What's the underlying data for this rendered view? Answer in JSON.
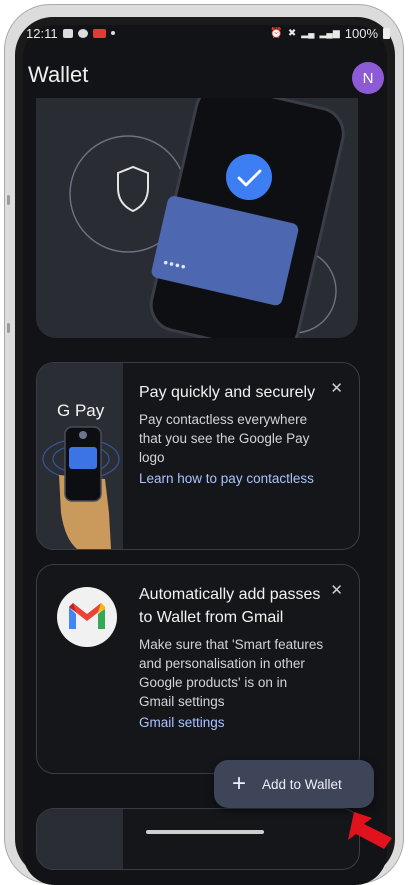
{
  "status_bar": {
    "time": "12:11",
    "battery": "100%"
  },
  "header": {
    "title": "Wallet",
    "avatar_initial": "N"
  },
  "cards": [
    {
      "title": "Pay quickly and securely",
      "text": "Pay contactless everywhere that you see the Google Pay logo",
      "link": "Learn how to pay contactless",
      "media_logo": "G Pay"
    },
    {
      "title": "Automatically add passes to Wallet from Gmail",
      "text": "Make sure that 'Smart features and personalisation in other Google products' is on in Gmail settings",
      "link": "Gmail settings"
    }
  ],
  "fab": {
    "label": "Add to Wallet"
  },
  "colors": {
    "background": "#121316",
    "card_border": "#3b3d45",
    "link": "#a9c3ff",
    "avatar": "#8e5bd6",
    "fab": "#3e4558",
    "annotation_arrow": "#e0121d"
  }
}
